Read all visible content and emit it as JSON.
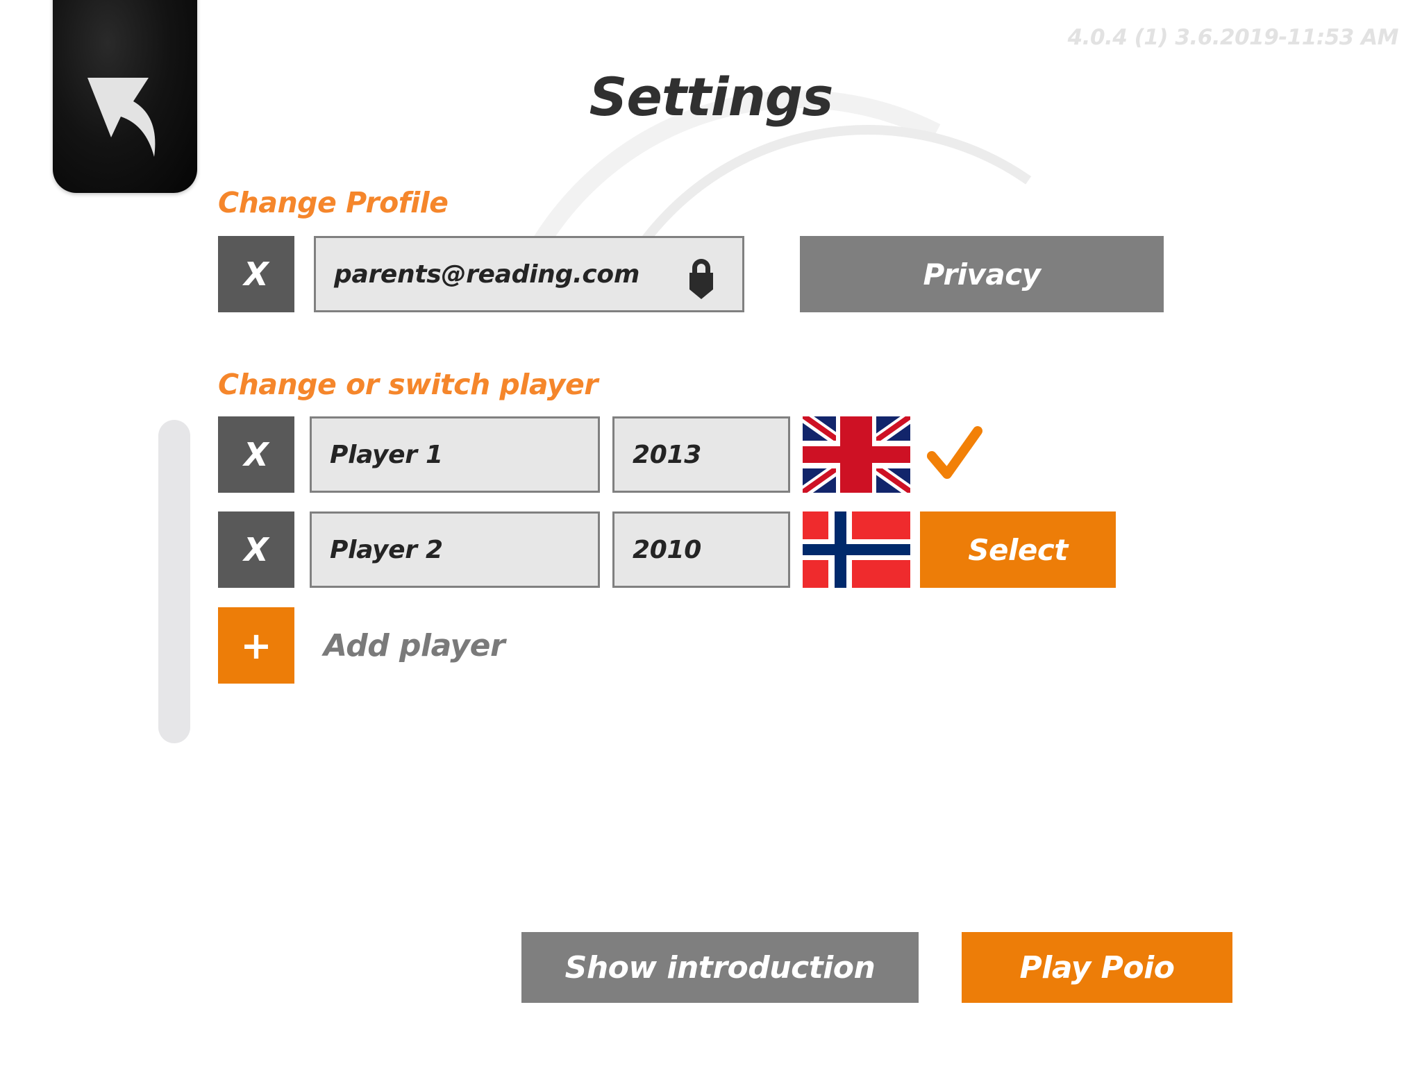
{
  "header": {
    "title": "Settings",
    "version_stamp": "4.0.4 (1)  3.6.2019-11:53 AM",
    "back_icon": "back-arrow-icon"
  },
  "colors": {
    "orange": "#ED7D08",
    "heading_orange": "#F5862B",
    "grey_button": "#7F7F7F",
    "dark_grey_button": "#595959",
    "field_bg": "#E7E7E7",
    "field_border": "#808080",
    "title": "#303030",
    "version_text": "#E2E2E2",
    "uk_navy": "#12256B",
    "uk_red": "#CE1124",
    "no_red": "#EF2B2D",
    "no_navy": "#00296B",
    "check_orange": "#F28007"
  },
  "profile_section": {
    "heading": "Change Profile",
    "delete_label": "X",
    "email_value": "parents@reading.com",
    "email_placeholder": "parents@reading.com",
    "lock_icon": "lock-icon",
    "privacy_label": "Privacy"
  },
  "player_section": {
    "heading": "Change or switch player",
    "delete_label": "X",
    "select_label": "Select",
    "check_icon": "checkmark-icon",
    "players": [
      {
        "name": "Player 1",
        "year": "2013",
        "flag": "flag-united-kingdom",
        "active": true,
        "action_label": ""
      },
      {
        "name": "Player 2",
        "year": "2010",
        "flag": "flag-norway",
        "active": false,
        "action_label": "Select"
      }
    ],
    "add_player": {
      "plus_label": "+",
      "label": "Add player"
    }
  },
  "footer": {
    "show_introduction_label": "Show introduction",
    "play_poio_label": "Play Poio"
  }
}
